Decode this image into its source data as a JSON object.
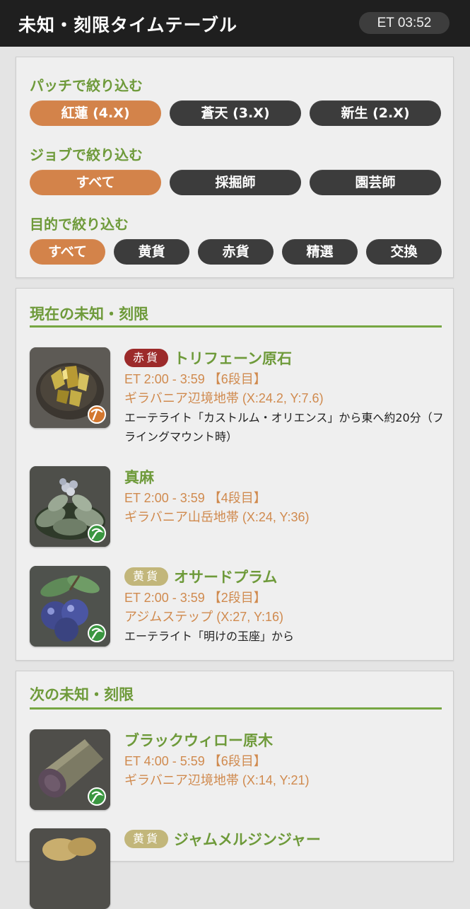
{
  "header": {
    "title": "未知・刻限タイムテーブル",
    "clock": "ET 03:52"
  },
  "filters": {
    "patch": {
      "heading": "パッチで絞り込む",
      "options": [
        "紅蓮 (4.X)",
        "蒼天 (3.X)",
        "新生 (2.X)"
      ],
      "selected": "紅蓮 (4.X)"
    },
    "job": {
      "heading": "ジョブで絞り込む",
      "options": [
        "すべて",
        "採掘師",
        "園芸師"
      ],
      "selected": "すべて"
    },
    "purpose": {
      "heading": "目的で絞り込む",
      "options": [
        "すべて",
        "黄貨",
        "赤貨",
        "精選",
        "交換"
      ],
      "selected": "すべて"
    }
  },
  "current": {
    "title": "現在の未知・刻限",
    "items": [
      {
        "tag": "赤貨",
        "tag_color": "#9c2a2a",
        "name": "トリフェーン原石",
        "time": "ET 2:00 - 3:59 【6段目】",
        "location": "ギラバニア辺境地帯 (X:24.2, Y:7.6)",
        "note": "エーテライト「カストルム・オリエンス」から東へ約20分（フライングマウント時）",
        "tool_icon": "pickaxe-icon",
        "thumb_icon": "ore-icon"
      },
      {
        "tag": "",
        "name": "真麻",
        "time": "ET 2:00 - 3:59 【4段目】",
        "location": "ギラバニア山岳地帯 (X:24, Y:36)",
        "note": "",
        "tool_icon": "sickle-icon",
        "thumb_icon": "plant-icon"
      },
      {
        "tag": "黄貨",
        "tag_color": "#c2b67a",
        "name": "オサードプラム",
        "time": "ET 2:00 - 3:59 【2段目】",
        "location": "アジムステップ (X:27, Y:16)",
        "note": "エーテライト「明けの玉座」から",
        "tool_icon": "sickle-icon",
        "thumb_icon": "plum-icon"
      }
    ]
  },
  "next": {
    "title": "次の未知・刻限",
    "items": [
      {
        "tag": "",
        "name": "ブラックウィロー原木",
        "time": "ET 4:00 - 5:59 【6段目】",
        "location": "ギラバニア辺境地帯 (X:14, Y:21)",
        "note": "",
        "tool_icon": "sickle-icon",
        "thumb_icon": "log-icon"
      },
      {
        "tag": "黄貨",
        "tag_color": "#c2b67a",
        "name": "ジャムメルジンジャー",
        "time": "",
        "location": "",
        "note": "",
        "tool_icon": "",
        "thumb_icon": "ginger-icon"
      }
    ]
  }
}
